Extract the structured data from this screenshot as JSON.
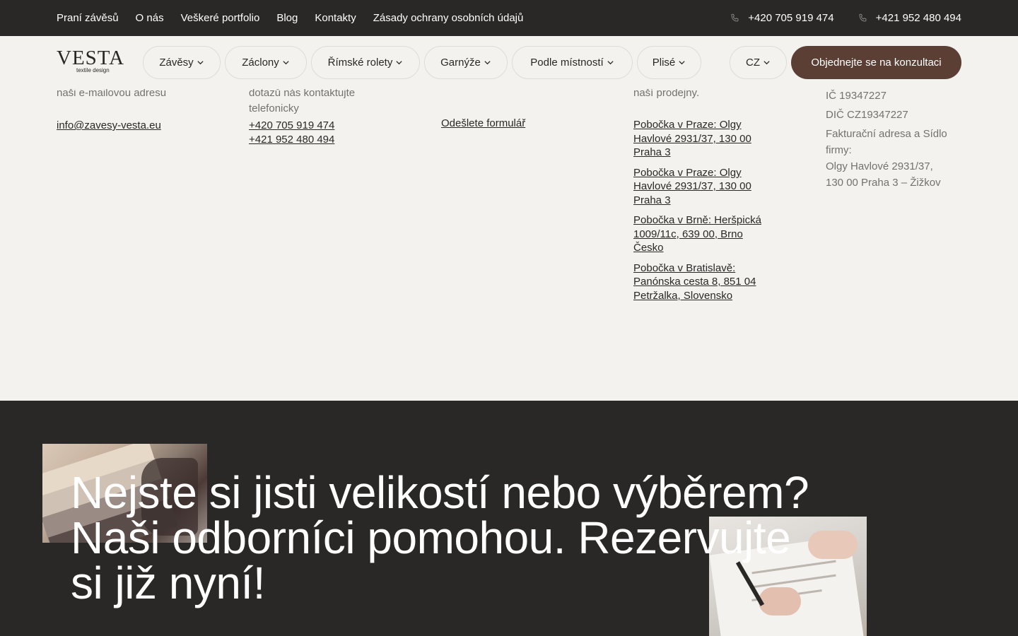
{
  "topbar": {
    "links": [
      "Praní závěsů",
      "O nás",
      "Veškeré portfolio",
      "Blog",
      "Kontakty",
      "Zásady ochrany osobních údajů"
    ],
    "phones": [
      "+420 705 919 474",
      "+421 952 480 494"
    ]
  },
  "header": {
    "logo": {
      "wordmark": "VESTA",
      "tagline": "textile design"
    },
    "nav": [
      "Závěsy",
      "Záclony",
      "Římské rolety",
      "Garnýže",
      "Podle místností",
      "Plisé"
    ],
    "language": "CZ",
    "cta_label": "Objednejte se na konzultaci"
  },
  "contacts": {
    "email": {
      "text": "naši e-mailovou adresu",
      "link": "info@zavesy-vesta.eu"
    },
    "phone": {
      "text_line1": "dotazů nás kontaktujte",
      "text_line2": "telefonicky",
      "links": [
        "+420 705 919 474",
        "+421 952 480 494"
      ]
    },
    "form": {
      "link": "Odešlete formulář"
    },
    "stores": {
      "text": "naší prodejny.",
      "links": [
        [
          "Pobočka v Praze: Olgy",
          "Havlové 2931/37, 130 00",
          "Praha 3"
        ],
        [
          "Pobočka v Praze: Olgy",
          "Havlové 2931/37, 130 00",
          "Praha 3"
        ],
        [
          "Pobočka v Brně: Heršpická",
          "1009/11c, 639 00, Brno",
          "Česko"
        ],
        [
          "Pobočka v Bratislavě:",
          "Panónska cesta 8, 851 04",
          "Petržalka, Slovensko"
        ]
      ]
    },
    "company": {
      "ic": "IČ 19347227",
      "dic": "DIČ  CZ19347227",
      "address_label_1": "Fakturační adresa a Sídlo",
      "address_label_2": "firmy:",
      "address_1": "Olgy Havlové 2931/37,",
      "address_2": "130 00 Praha 3 – Žižkov"
    }
  },
  "banner": {
    "headline_lines": [
      "Nejste si jisti velikostí nebo výběrem?",
      "Naši odborníci pomohou. Rezervujte",
      "si již nyní!"
    ]
  },
  "colors": {
    "dark": "#2a2826",
    "background": "#f3f2ef",
    "accent": "#5b3f34",
    "muted_text": "#75716d"
  }
}
